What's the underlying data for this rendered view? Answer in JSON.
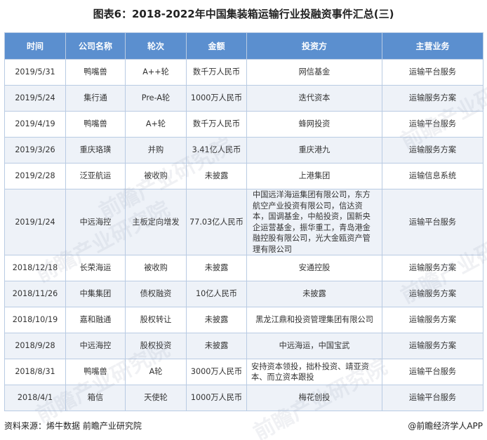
{
  "title": "图表6：2018-2022年中国集装箱运输行业投融资事件汇总(三)",
  "table": {
    "headers": [
      "时间",
      "公司名称",
      "轮次",
      "金额",
      "投资方",
      "主营业务"
    ],
    "rows": [
      [
        "2019/5/31",
        "鸭嘴兽",
        "A++轮",
        "数千万人民币",
        "网信基金",
        "运输平台服务"
      ],
      [
        "2019/5/24",
        "集行通",
        "Pre-A轮",
        "1000万人民币",
        "迭代资本",
        "运输服务方案"
      ],
      [
        "2019/4/19",
        "鸭嘴兽",
        "A+轮",
        "数千万人民币",
        "蜂网投资",
        "运输平台服务"
      ],
      [
        "2019/3/26",
        "重庆珞璜",
        "并购",
        "3.41亿人民币",
        "重庆港九",
        "运输服务方案"
      ],
      [
        "2019/2/28",
        "泛亚航运",
        "被收购",
        "未披露",
        "上港集团",
        "运输信息系统"
      ],
      [
        "2019/1/24",
        "中远海控",
        "主板定向增发",
        "77.03亿人民币",
        "中国远洋海运集团有限公司，东方航空产业投资有限公司，信达资本，国调基金，中船投资，国新央企运营基金，振华重工，青岛港金融控股有限公司，光大金瓯资产管理有限公司",
        "运输平台服务"
      ],
      [
        "2018/12/18",
        "长荣海运",
        "被收购",
        "未披露",
        "安通控股",
        "运输服务方案"
      ],
      [
        "2018/11/26",
        "中集集团",
        "债权融资",
        "10亿人民币",
        "未披露",
        "运输服务方案"
      ],
      [
        "2018/10/19",
        "嘉和融通",
        "股权转让",
        "未披露",
        "黑龙江鼎和投资管理集团有限公司",
        "运输服务方案"
      ],
      [
        "2018/9/28",
        "中远海控",
        "股权投资",
        "未披露",
        "中远海运，中国宝武",
        "运输服务方案"
      ],
      [
        "2018/8/31",
        "鸭嘴兽",
        "A轮",
        "3000万人民币",
        "安持资本领投，拙朴投资、靖亚资本、而立资本跟投",
        "运输平台服务"
      ],
      [
        "2018/4/1",
        "箱信",
        "天使轮",
        "1000万人民币",
        "梅花创投",
        "运输平台服务"
      ]
    ]
  },
  "footer": {
    "source": "资料来源：烯牛数据 前瞻产业研究院",
    "brand": "@前瞻经济学人APP"
  },
  "watermark_text": "前瞻产业研究院",
  "colors": {
    "header_bg": "#5b8fcf",
    "stripe_bg": "#eef2f8",
    "border": "#b9cbe3"
  }
}
